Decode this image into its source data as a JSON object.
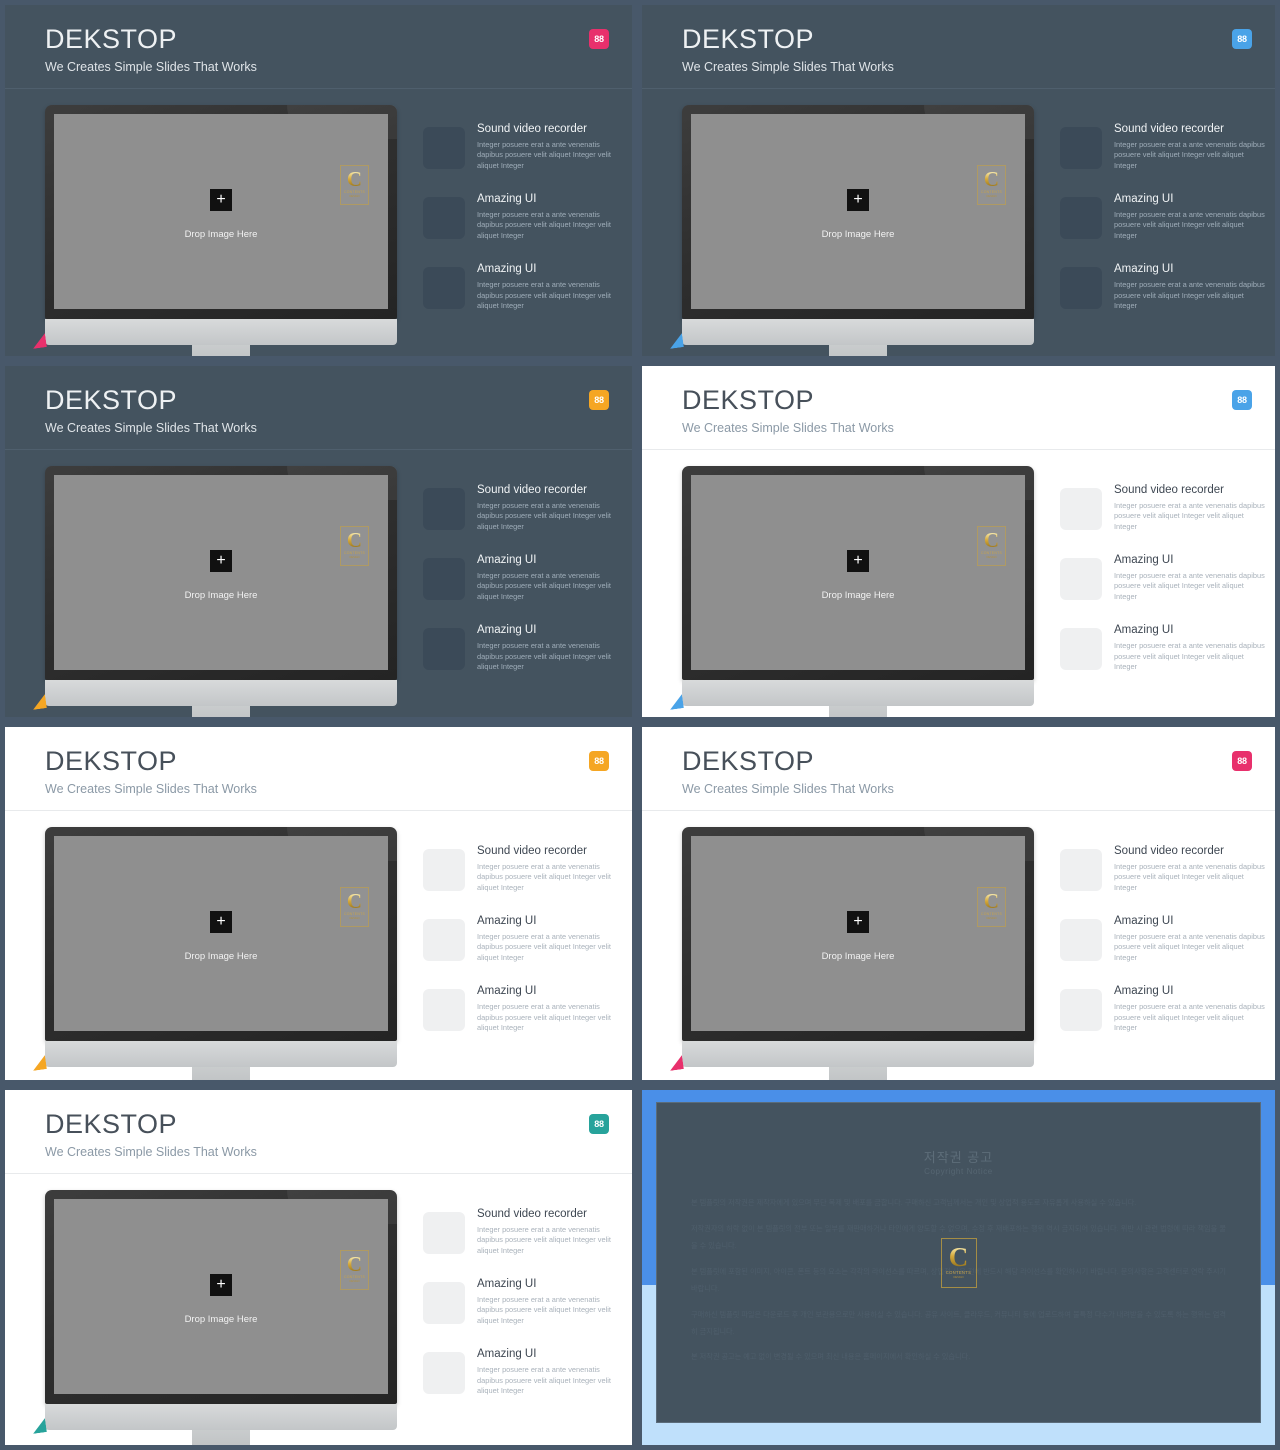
{
  "deck": {
    "slide_title": "DEKSTOP",
    "slide_subtitle": "We Creates Simple Slides That Works",
    "badge_text": "88",
    "drop_plus": "+",
    "drop_label": "Drop Image Here",
    "watermark": {
      "letter": "C",
      "line1": "CONTENTS",
      "line2": "DESIGN"
    }
  },
  "features": [
    {
      "heading": "Sound video recorder",
      "body": "Integer posuere erat a ante venenatis dapibus posuere velit aliquet Integer velit aliquet Integer"
    },
    {
      "heading": "Amazing UI",
      "body": "Integer posuere erat a ante venenatis dapibus posuere velit aliquet Integer velit aliquet Integer"
    },
    {
      "heading": "Amazing UI",
      "body": "Integer posuere erat a ante venenatis dapibus posuere velit aliquet Integer velit aliquet Integer"
    }
  ],
  "colors": {
    "dark_bg": "#44535f",
    "light_bg": "#ffffff",
    "page_bg": "#48586a",
    "badge_pink": "#e8306c",
    "badge_blue": "#4aa3e8",
    "badge_orange": "#f5a623",
    "badge_teal": "#27a39b",
    "copyright_blue": "#4a8fe8",
    "copyright_blue_light": "#bfe0fb"
  },
  "slides": [
    {
      "theme": "dark",
      "badge_color": "#e8306c",
      "accent_color": "#e8306c"
    },
    {
      "theme": "dark",
      "badge_color": "#4aa3e8",
      "accent_color": "#4aa3e8"
    },
    {
      "theme": "dark",
      "badge_color": "#f5a623",
      "accent_color": "#f5a623"
    },
    {
      "theme": "light",
      "badge_color": "#4aa3e8",
      "accent_color": "#4aa3e8"
    },
    {
      "theme": "light",
      "badge_color": "#f5a623",
      "accent_color": "#f5a623"
    },
    {
      "theme": "light",
      "badge_color": "#e8306c",
      "accent_color": "#e8306c"
    },
    {
      "theme": "light",
      "badge_color": "#27a39b",
      "accent_color": "#27a39b"
    }
  ],
  "copyright": {
    "title": "저작권 공고",
    "subtitle": "Copyright Notice",
    "paragraphs": [
      "본 템플릿의 저작권은 제작자에게 있으며 무단 복제 및 배포를 금합니다. 구매하신 고객님께서는 개인 및 상업적 용도로 자유롭게 사용하실 수 있습니다.",
      "저작권자의 허락 없이 본 템플릿의 전부 또는 일부를 재판매하거나 타인에게 양도할 수 없으며, 수정 후 재배포하는 행위 역시 금지되어 있습니다. 위반 시 관련 법령에 따라 책임을 물을 수 있습니다.",
      "본 템플릿에 포함된 이미지, 아이콘, 폰트 등의 요소는 각각의 라이선스를 따르며, 상업적 사용 전에 반드시 해당 라이선스를 확인하시기 바랍니다. 문의사항은 고객센터로 연락 주시기 바랍니다.",
      "구매하신 템플릿 파일은 다운로드 후 개인 보관용으로만 사용하실 수 있습니다. 공유 사이트, 클라우드, 커뮤니티 등에 업로드하여 불특정 다수가 내려받을 수 있도록 하는 행위는 엄격히 금지됩니다.",
      "본 저작권 공고는 예고 없이 변경될 수 있으며 최신 내용은 홈페이지에서 확인하실 수 있습니다."
    ]
  }
}
